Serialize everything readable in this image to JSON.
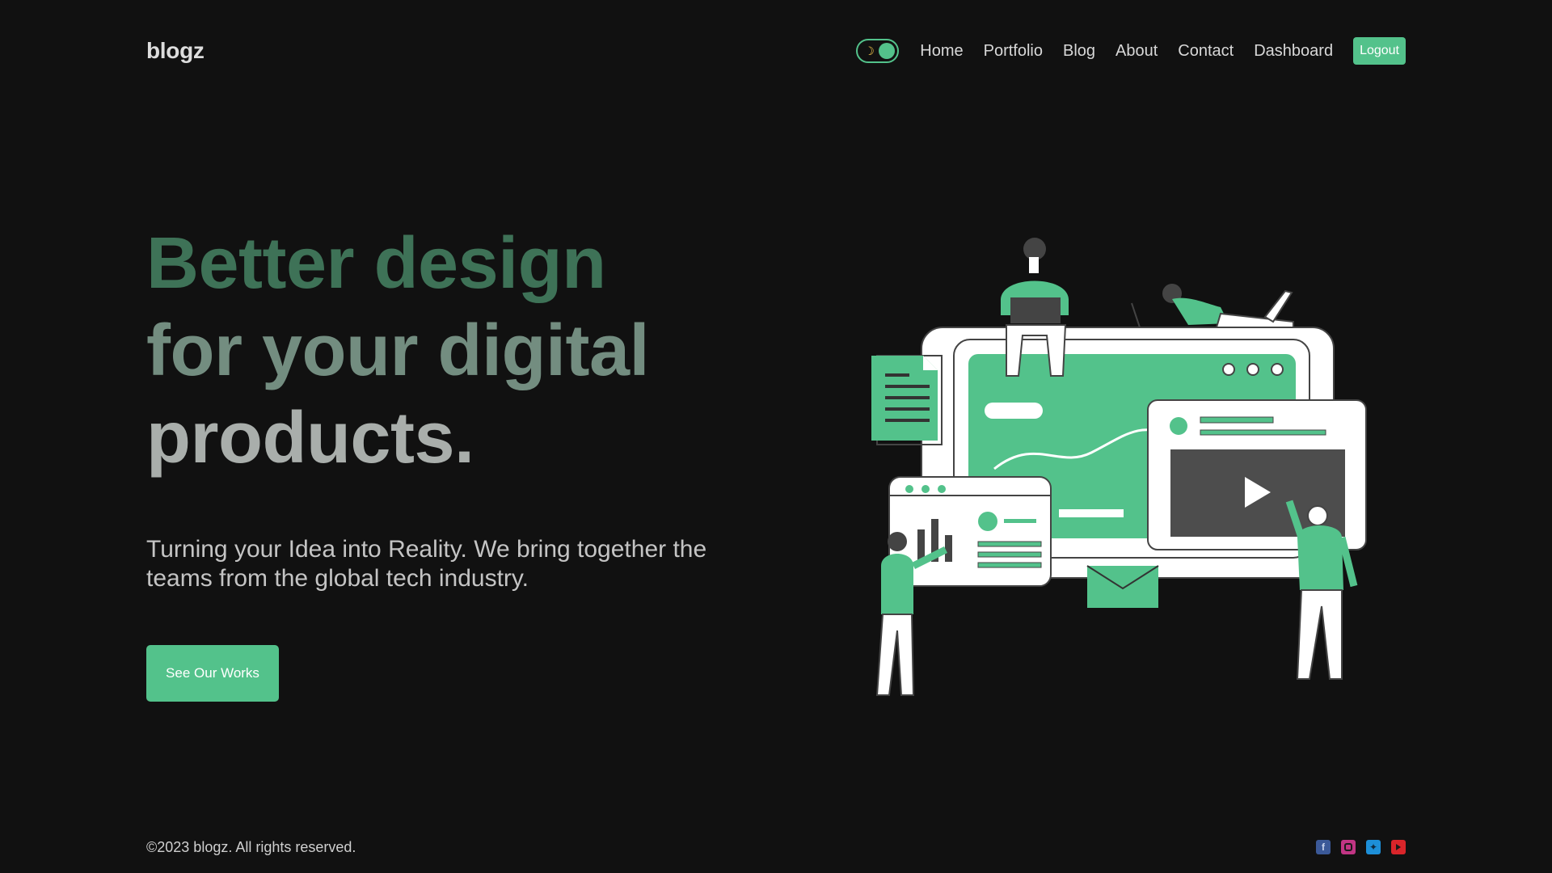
{
  "brand": {
    "name": "blogz",
    "accent": "#53c28b",
    "background": "#111111"
  },
  "nav": {
    "theme_toggle_icon": "moon-icon",
    "links": [
      "Home",
      "Portfolio",
      "Blog",
      "About",
      "Contact",
      "Dashboard"
    ],
    "logout_label": "Logout"
  },
  "hero": {
    "title_lines": [
      "Better design",
      "for your digital",
      "products."
    ],
    "subtitle": "Turning your Idea into Reality. We bring together the teams from the global tech industry.",
    "cta_label": "See Our Works"
  },
  "footer": {
    "copyright": "©2023 blogz. All rights reserved.",
    "socials": [
      "facebook-icon",
      "instagram-icon",
      "twitter-icon",
      "youtube-icon"
    ]
  }
}
